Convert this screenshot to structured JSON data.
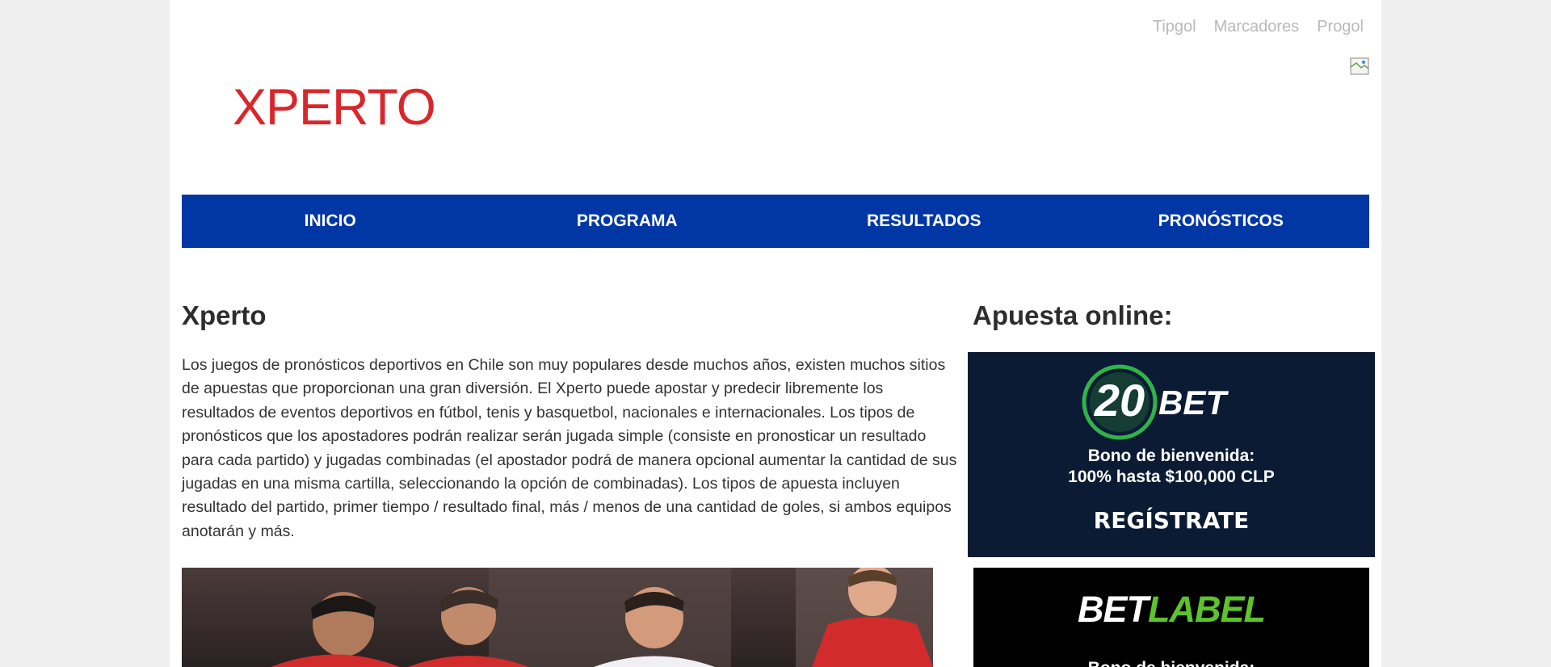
{
  "top_links": [
    "Tipgol",
    "Marcadores",
    "Progol"
  ],
  "logo": {
    "text": "XPERTO",
    "color": "#d9262b"
  },
  "nav": {
    "color": "#0037a5",
    "items": [
      "INICIO",
      "PROGRAMA",
      "RESULTADOS",
      "PRONÓSTICOS"
    ]
  },
  "main": {
    "title": "Xperto",
    "intro": "Los juegos de pronósticos deportivos en Chile son muy populares desde muchos años, existen muchos sitios de apuestas que proporcionan una gran diversión. El Xperto puede apostar y predecir libremente los resultados de eventos deportivos en fútbol, tenis y basquetbol, nacionales e internacionales. Los tipos de pronósticos que los apostadores podrán realizar serán jugada simple (consiste en pronosticar un resultado para cada partido) y jugadas combinadas (el apostador podrá de manera opcional aumentar la cantidad de sus jugadas en una misma cartilla, seleccionando la opción de combinadas). Los tipos de apuesta incluyen resultado del partido, primer tiempo / resultado final, más / menos de una cantidad de goles, si ambos equipos anotarán y más."
  },
  "sidebar": {
    "title": "Apuesta online:",
    "ad_20bet": {
      "brand_number": "20",
      "brand_word": "BET",
      "bonus_line1": "Bono de bienvenida:",
      "bonus_line2": "100% hasta $100,000 CLP",
      "cta": "REGÍSTRATE",
      "bg": "#0b1b33",
      "accent": "#2fb34a"
    },
    "ad_betlabel": {
      "brand_a": "BET",
      "brand_b": "LABEL",
      "bonus_line1": "Bono de bienvenida:",
      "bg": "#000000",
      "accent": "#5dc32b"
    }
  }
}
